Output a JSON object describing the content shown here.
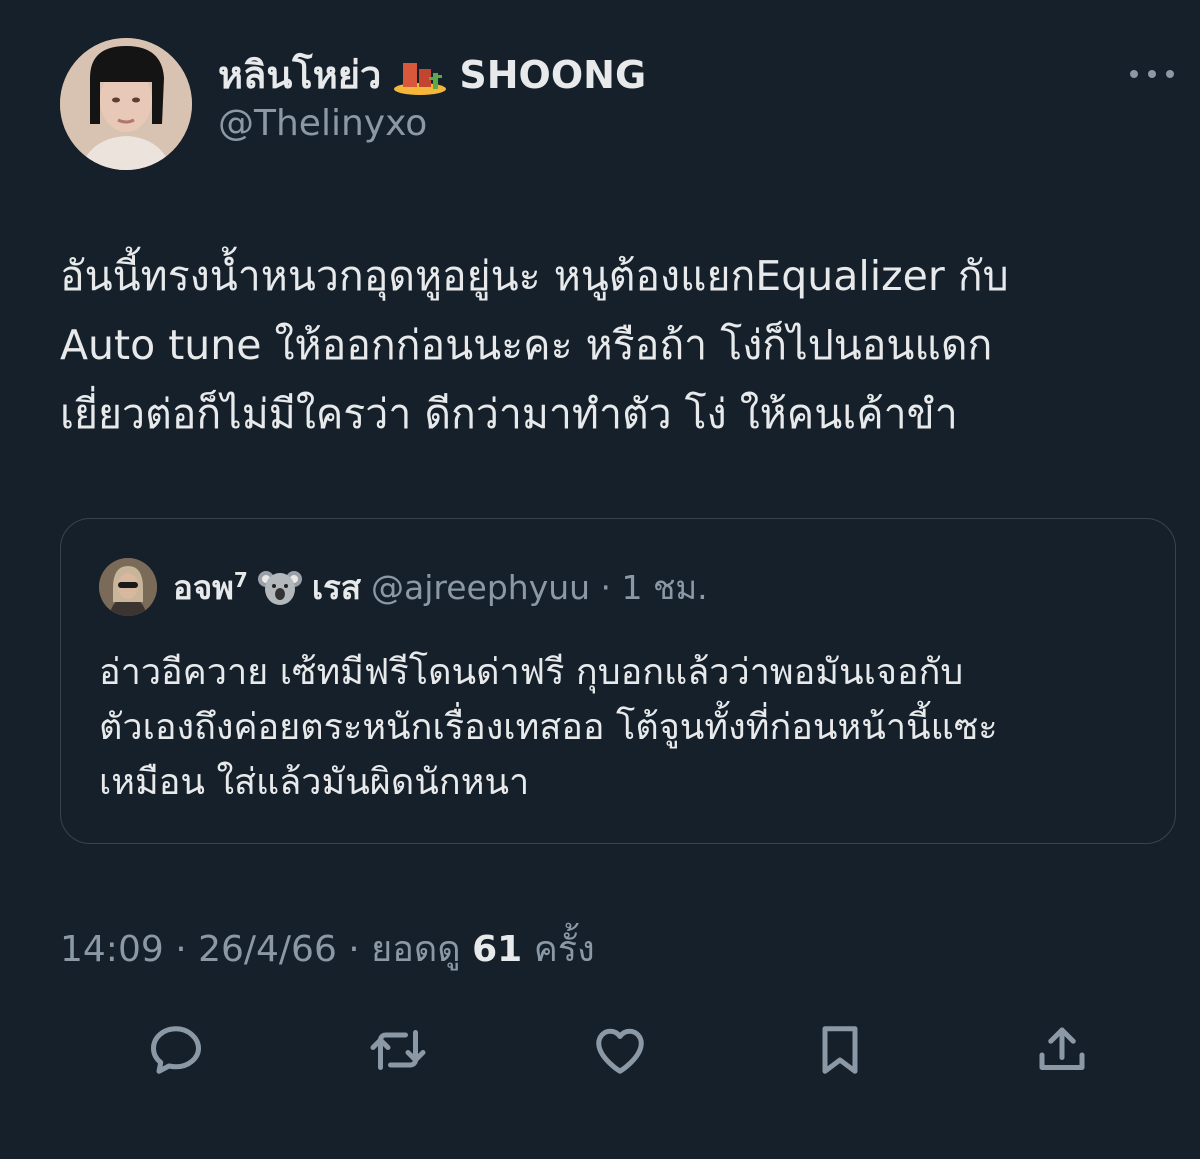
{
  "author": {
    "display_name": "หลินโหย่ว",
    "display_name_suffix": "SHOONG",
    "handle": "@Thelinyxo"
  },
  "tweet": {
    "text": "อันนี้ทรงน้ำหนวกอุดหูอยู่นะ หนูต้องแยกEqualizer กับ\nAuto tune ให้ออกก่อนนะคะ หรือถ้า โง่ก็ไปนอนแดก\nเยี่ยวต่อก็ไม่มีใครว่า ดีกว่ามาทำตัว โง่ ให้คนเค้าขำ"
  },
  "quoted": {
    "name": "อจพ",
    "name_sup": "7",
    "name2": "เรส",
    "handle_time": "@ajreephyuu · 1 ชม.",
    "text": "อ่าวอีควาย เซ้ทมีฟรีโดนด่าฟรี กุบอกแล้วว่าพอมันเจอกับ\nตัวเองถึงค่อยตระหนักเรื่องเทสออ โต้จูนทั้งที่ก่อนหน้านี้แซะ\nเหมือน ใส่แล้วมันผิดนักหนา"
  },
  "meta": {
    "prefix": "14:09 · 26/4/66 · ยอดดู",
    "views": "61",
    "suffix": "ครั้ง"
  },
  "icons": [
    "more-icon",
    "reply-icon",
    "retweet-icon",
    "like-icon",
    "bookmark-icon",
    "share-icon"
  ],
  "colors": {
    "background": "#15202b",
    "text": "#e7e9ea",
    "secondary": "#8b98a5",
    "border": "#38444d"
  }
}
